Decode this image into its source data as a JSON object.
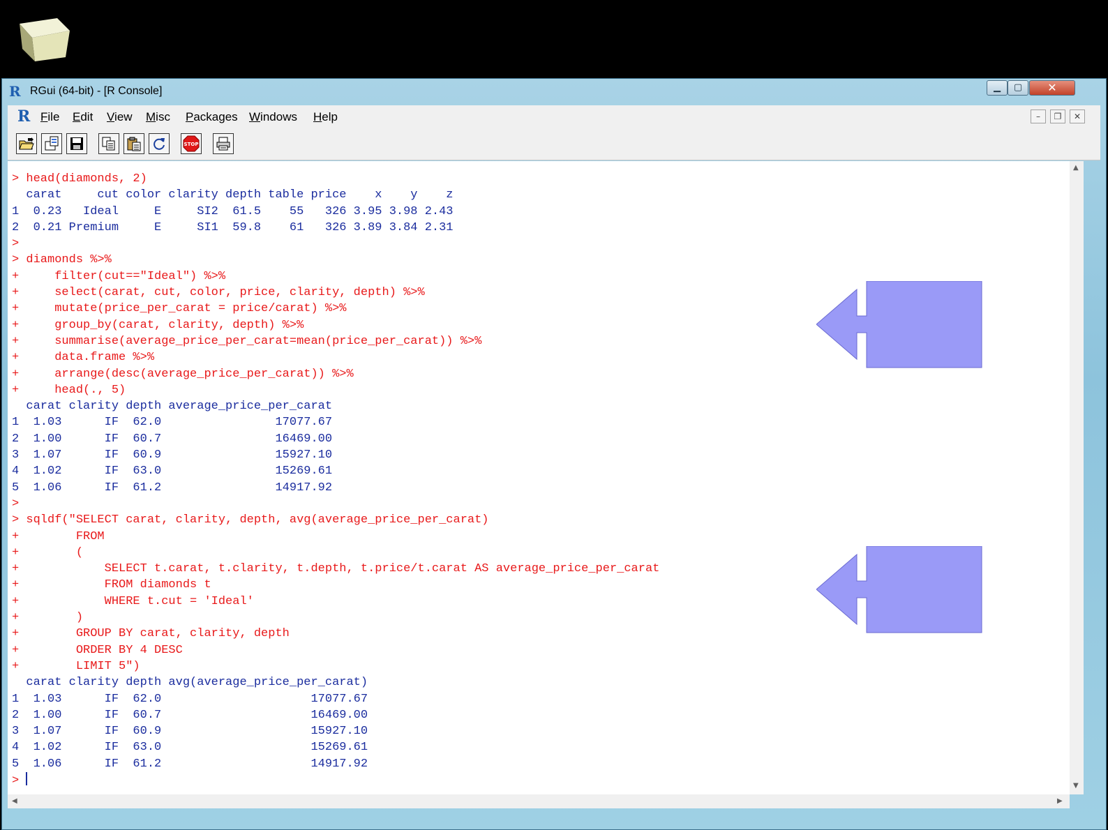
{
  "window": {
    "title": "RGui (64-bit) - [R Console]",
    "minimize_glyph": "▁",
    "maximize_glyph": "▢",
    "close_glyph": "✕"
  },
  "menu": {
    "items": [
      {
        "key": "F",
        "rest": "ile"
      },
      {
        "key": "E",
        "rest": "dit"
      },
      {
        "key": "V",
        "rest": "iew"
      },
      {
        "key": "M",
        "rest": "isc"
      },
      {
        "key": "P",
        "rest": "ackages"
      },
      {
        "key": "W",
        "rest": "indows"
      },
      {
        "key": "H",
        "rest": "elp"
      }
    ],
    "mdi_minimize": "–",
    "mdi_restore": "❐",
    "mdi_close": "✕"
  },
  "toolbar": {
    "icons": [
      "open-script-icon",
      "load-workspace-icon",
      "save-workspace-icon",
      "copy-icon",
      "paste-icon",
      "copy-paste-icon",
      "stop-icon",
      "print-icon"
    ],
    "stop_label": "STOP"
  },
  "console": {
    "lines": [
      {
        "t": "in",
        "s": "> head(diamonds, 2)"
      },
      {
        "t": "out",
        "s": "  carat     cut color clarity depth table price    x    y    z"
      },
      {
        "t": "out",
        "s": "1  0.23   Ideal     E     SI2  61.5    55   326 3.95 3.98 2.43"
      },
      {
        "t": "out",
        "s": "2  0.21 Premium     E     SI1  59.8    61   326 3.89 3.84 2.31"
      },
      {
        "t": "in",
        "s": ">"
      },
      {
        "t": "in",
        "s": "> diamonds %>%"
      },
      {
        "t": "in",
        "s": "+     filter(cut==\"Ideal\") %>%"
      },
      {
        "t": "in",
        "s": "+     select(carat, cut, color, price, clarity, depth) %>%"
      },
      {
        "t": "in",
        "s": "+     mutate(price_per_carat = price/carat) %>%"
      },
      {
        "t": "in",
        "s": "+     group_by(carat, clarity, depth) %>%"
      },
      {
        "t": "in",
        "s": "+     summarise(average_price_per_carat=mean(price_per_carat)) %>%"
      },
      {
        "t": "in",
        "s": "+     data.frame %>%"
      },
      {
        "t": "in",
        "s": "+     arrange(desc(average_price_per_carat)) %>%"
      },
      {
        "t": "in",
        "s": "+     head(., 5)"
      },
      {
        "t": "out",
        "s": "  carat clarity depth average_price_per_carat"
      },
      {
        "t": "out",
        "s": "1  1.03      IF  62.0                17077.67"
      },
      {
        "t": "out",
        "s": "2  1.00      IF  60.7                16469.00"
      },
      {
        "t": "out",
        "s": "3  1.07      IF  60.9                15927.10"
      },
      {
        "t": "out",
        "s": "4  1.02      IF  63.0                15269.61"
      },
      {
        "t": "out",
        "s": "5  1.06      IF  61.2                14917.92"
      },
      {
        "t": "in",
        "s": ">"
      },
      {
        "t": "in",
        "s": "> sqldf(\"SELECT carat, clarity, depth, avg(average_price_per_carat)"
      },
      {
        "t": "in",
        "s": "+        FROM"
      },
      {
        "t": "in",
        "s": "+        ("
      },
      {
        "t": "in",
        "s": "+            SELECT t.carat, t.clarity, t.depth, t.price/t.carat AS average_price_per_carat"
      },
      {
        "t": "in",
        "s": "+            FROM diamonds t"
      },
      {
        "t": "in",
        "s": "+            WHERE t.cut = 'Ideal'"
      },
      {
        "t": "in",
        "s": "+        )"
      },
      {
        "t": "in",
        "s": "+        GROUP BY carat, clarity, depth"
      },
      {
        "t": "in",
        "s": "+        ORDER BY 4 DESC"
      },
      {
        "t": "in",
        "s": "+        LIMIT 5\")"
      },
      {
        "t": "out",
        "s": "  carat clarity depth avg(average_price_per_carat)"
      },
      {
        "t": "out",
        "s": "1  1.03      IF  62.0                     17077.67"
      },
      {
        "t": "out",
        "s": "2  1.00      IF  60.7                     16469.00"
      },
      {
        "t": "out",
        "s": "3  1.07      IF  60.9                     15927.10"
      },
      {
        "t": "out",
        "s": "4  1.02      IF  63.0                     15269.61"
      },
      {
        "t": "out",
        "s": "5  1.06      IF  61.2                     14917.92"
      }
    ],
    "prompt": "> "
  },
  "colors": {
    "input": "#e8191a",
    "output": "#1a2c9e",
    "callout": "#9a9af7"
  }
}
